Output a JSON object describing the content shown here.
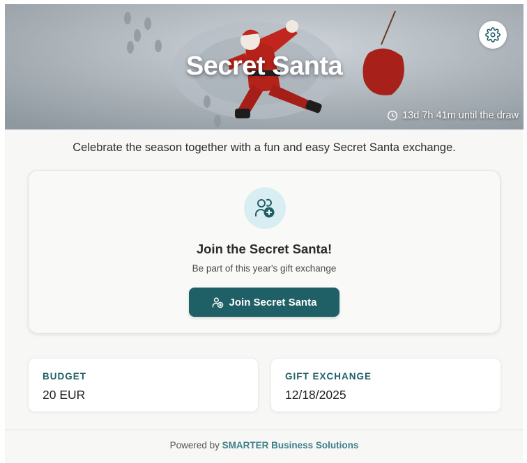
{
  "hero": {
    "title": "Secret Santa",
    "countdown": "13d 7h 41m until the draw",
    "icons": {
      "settings": "gear-icon",
      "countdown": "clock-icon"
    }
  },
  "tagline": "Celebrate the season together with a fun and easy Secret Santa exchange.",
  "join": {
    "icon": "user-plus-icon",
    "title": "Join the Secret Santa!",
    "subtitle": "Be part of this year's gift exchange",
    "button_label": "Join Secret Santa"
  },
  "info": {
    "budget_label": "BUDGET",
    "budget_value": "20 EUR",
    "exchange_label": "GIFT EXCHANGE",
    "exchange_value": "12/18/2025"
  },
  "footer": {
    "prefix": "Powered by",
    "link": "SMARTER Business Solutions"
  },
  "colors": {
    "accent": "#1f5f66",
    "accent_light": "#d9eef2",
    "link": "#3f7f88",
    "background": "#f7f7f6"
  }
}
